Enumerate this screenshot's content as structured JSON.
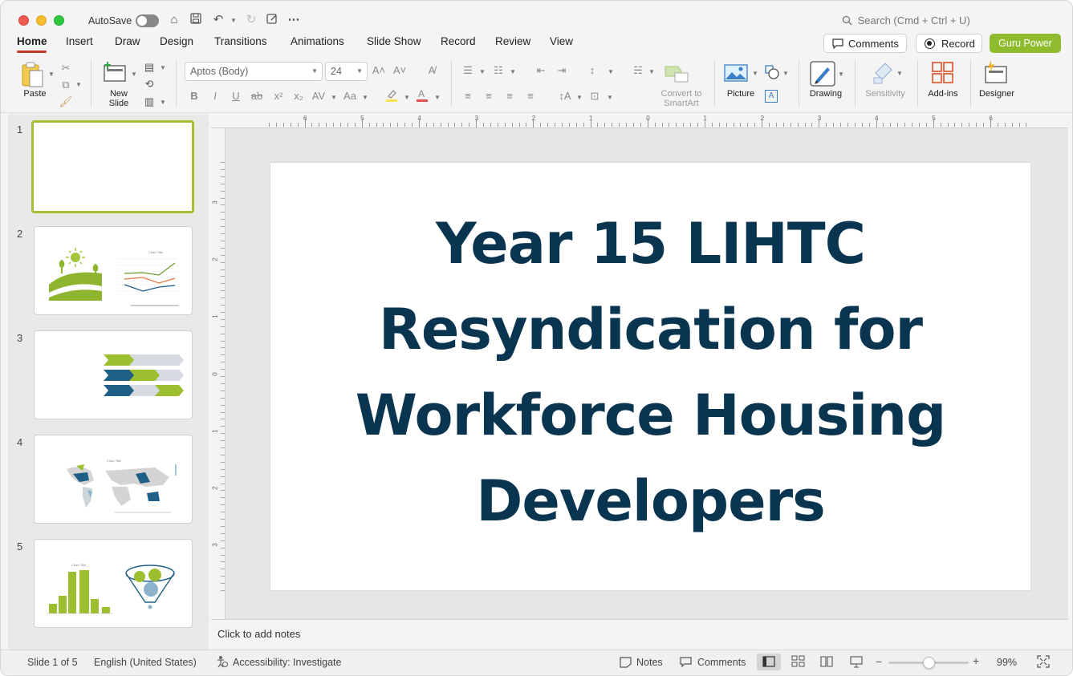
{
  "titlebar": {
    "autosave_label": "AutoSave",
    "search_placeholder": "Search (Cmd + Ctrl + U)"
  },
  "tabs": [
    {
      "label": "Home"
    },
    {
      "label": "Insert"
    },
    {
      "label": "Draw"
    },
    {
      "label": "Design"
    },
    {
      "label": "Transitions"
    },
    {
      "label": "Animations"
    },
    {
      "label": "Slide Show"
    },
    {
      "label": "Record"
    },
    {
      "label": "Review"
    },
    {
      "label": "View"
    }
  ],
  "header_buttons": {
    "comments": "Comments",
    "record": "Record",
    "guru": "Guru Power"
  },
  "ribbon": {
    "paste": "Paste",
    "new_slide_1": "New",
    "new_slide_2": "Slide",
    "font_name": "Aptos (Body)",
    "font_size": "24",
    "smartart_1": "Convert to",
    "smartart_2": "SmartArt",
    "picture": "Picture",
    "drawing": "Drawing",
    "sensitivity": "Sensitivity",
    "addins": "Add-ins",
    "designer": "Designer"
  },
  "slides": [
    {
      "num": "1"
    },
    {
      "num": "2"
    },
    {
      "num": "3"
    },
    {
      "num": "4"
    },
    {
      "num": "5"
    }
  ],
  "ruler_h": [
    "6",
    "5",
    "4",
    "3",
    "2",
    "1",
    "0",
    "1",
    "2",
    "3",
    "4",
    "5",
    "6"
  ],
  "ruler_v": [
    "3",
    "2",
    "1",
    "0",
    "1",
    "2",
    "3"
  ],
  "slide": {
    "title_lines": [
      "Year 15 LIHTC",
      "Resyndication for",
      "Workforce Housing",
      "Developers"
    ],
    "title_color": "#0a3550"
  },
  "notes": {
    "placeholder": "Click to add notes"
  },
  "status": {
    "slide_indicator": "Slide 1 of 5",
    "language": "English (United States)",
    "accessibility": "Accessibility: Investigate",
    "notes": "Notes",
    "comments": "Comments",
    "zoom": "99%",
    "zoom_level": 0.5
  },
  "colors": {
    "accent_green": "#8fbc2e",
    "dark_blue": "#0a3550",
    "tab_underline": "#c0392b"
  }
}
